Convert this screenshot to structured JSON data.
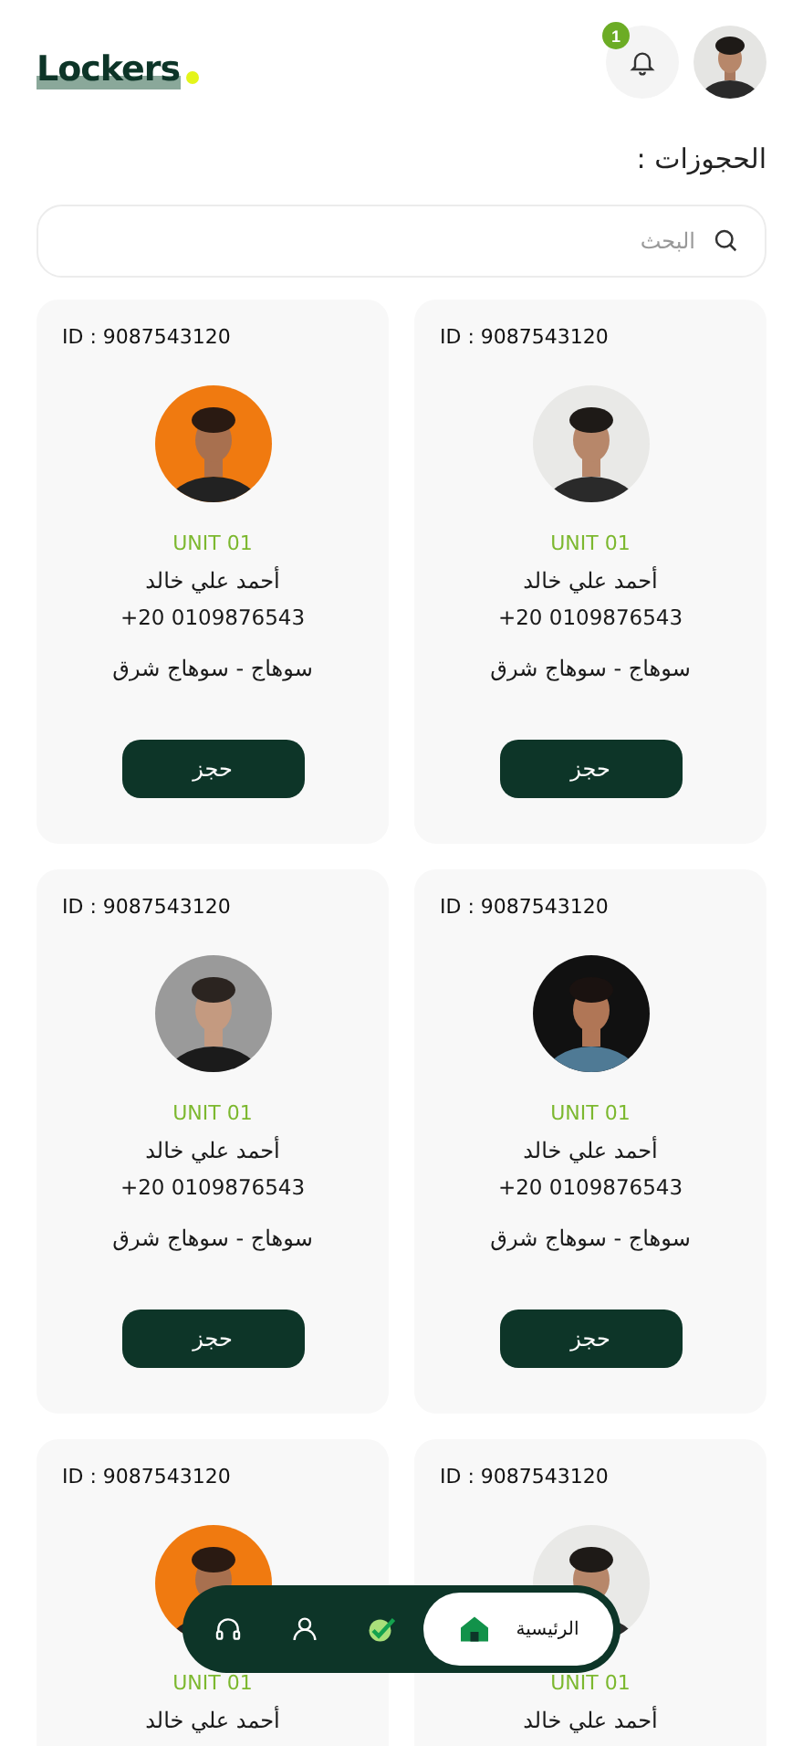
{
  "header": {
    "logo": "Lockers",
    "notification_count": "1"
  },
  "title": "الحجوزات :",
  "search": {
    "placeholder": "البحث"
  },
  "cards": [
    {
      "id": "ID : 9087543120",
      "unit": "UNIT 01",
      "name": "أحمد علي خالد",
      "phone": "+20 0109876543",
      "location": "سوهاج - سوهاج شرق",
      "action": "حجز"
    },
    {
      "id": "ID : 9087543120",
      "unit": "UNIT 01",
      "name": "أحمد علي خالد",
      "phone": "+20 0109876543",
      "location": "سوهاج - سوهاج شرق",
      "action": "حجز"
    },
    {
      "id": "ID : 9087543120",
      "unit": "UNIT 01",
      "name": "أحمد علي خالد",
      "phone": "+20 0109876543",
      "location": "سوهاج - سوهاج شرق",
      "action": "حجز"
    },
    {
      "id": "ID : 9087543120",
      "unit": "UNIT 01",
      "name": "أحمد علي خالد",
      "phone": "+20 0109876543",
      "location": "سوهاج - سوهاج شرق",
      "action": "حجز"
    },
    {
      "id": "ID : 9087543120",
      "unit": "UNIT 01",
      "name": "أحمد علي خالد"
    },
    {
      "id": "ID : 9087543120",
      "unit": "UNIT 01",
      "name": "أحمد علي خالد"
    }
  ],
  "nav": [
    {
      "kind": "home",
      "label": "الرئيسية",
      "selected": true
    },
    {
      "kind": "bookings",
      "selected": false
    },
    {
      "kind": "profile",
      "selected": false
    },
    {
      "kind": "support",
      "selected": false
    }
  ]
}
